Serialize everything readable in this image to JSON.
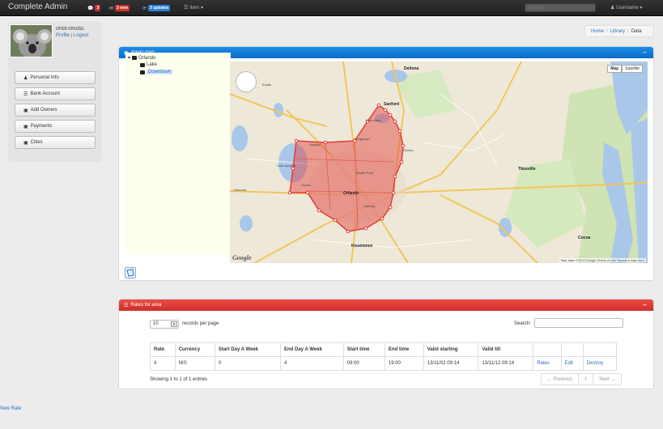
{
  "app": {
    "brand": "Complete Admin"
  },
  "navbar": {
    "messages_count": "3",
    "new_label": "3 new",
    "updates_label": "3 updates",
    "item_label": "Item",
    "search_placeholder": "Search",
    "username": "Username"
  },
  "user": {
    "name": "OFER KRUZEL",
    "profile": "Profile",
    "separator": "|",
    "logout": "Logout"
  },
  "sidebar": {
    "items": [
      {
        "label": "Personal Info"
      },
      {
        "label": "Bank Account"
      },
      {
        "label": "Add Owners"
      },
      {
        "label": "Payments"
      },
      {
        "label": "Cities"
      }
    ]
  },
  "breadcrumb": {
    "home": "Home",
    "library": "Library",
    "current": "Data",
    "sep": "/"
  },
  "areas_panel": {
    "title": "Areas map",
    "tree": {
      "root": "Orlando",
      "child1": "Lake",
      "child2": "Downtown"
    },
    "map_type": {
      "map": "Map",
      "satellite": "Satellite"
    },
    "map_footer": "Map data ©2013 Google   Terms of Use   Report a map error",
    "google": "Google",
    "places": {
      "orlando": "Orlando",
      "sanford": "Sanford",
      "deltona": "Deltona",
      "longwood": "Longwood",
      "apopka": "Apopka",
      "ocoee": "Ocoee",
      "winter_park": "Winter Park",
      "conway": "Conway",
      "kissimmee": "Kissimmee",
      "titusville": "Titusville",
      "eustis": "Eustis",
      "clermont": "Clermont",
      "lake_apopka": "Lake Apopka",
      "lake_mary": "Lake Mary",
      "oviedo": "Oviedo",
      "cocoa": "Cocoa"
    }
  },
  "rates_panel": {
    "title": "Rates for area",
    "length_value": "10",
    "length_label": "records per page",
    "search_label": "Search:",
    "columns": [
      "Rate",
      "Currency",
      "Start Day A Week",
      "End Day A Week",
      "Start time",
      "End time",
      "Valid starting",
      "Valid till",
      "",
      "",
      ""
    ],
    "rows": [
      [
        "4",
        "NIS",
        "0",
        "4",
        "09:00",
        "19:00",
        "13/11/02 09:14",
        "13/11/12 09:14",
        "Rates",
        "Edit",
        "Destroy"
      ]
    ],
    "info": "Showing 1 to 1 of 1 entries",
    "pager": {
      "prev": "← Previous",
      "page": "1",
      "next": "Next →"
    }
  },
  "footer": {
    "new_rate": "New Rate"
  }
}
